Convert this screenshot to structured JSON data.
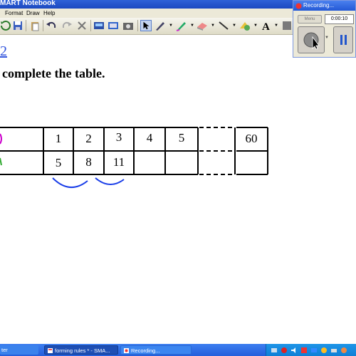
{
  "window": {
    "title": "MART Notebook"
  },
  "menu": {
    "items": [
      "Format",
      "Draw",
      "Help"
    ]
  },
  "page": {
    "link_text": "2",
    "instruction": "complete the table."
  },
  "table": {
    "row1": [
      "1",
      "2",
      "3",
      "4",
      "5",
      "60"
    ],
    "row2": [
      "5",
      "8",
      "11",
      "",
      "",
      ""
    ]
  },
  "recorder": {
    "title": "Recording...",
    "menu_label": "Menu",
    "time": "0:00:10"
  },
  "taskbar": {
    "start_fragment": "ter",
    "tasks": [
      "forming rules * - SMA...",
      "Recording..."
    ]
  },
  "colors": {
    "title_bar": "#2f62d8",
    "link": "#3355dd",
    "annotation": "#1a3ee8",
    "row_marker_1": "#cc00cc",
    "row_marker_2": "#33aa33",
    "taskbar": "#245edb"
  }
}
